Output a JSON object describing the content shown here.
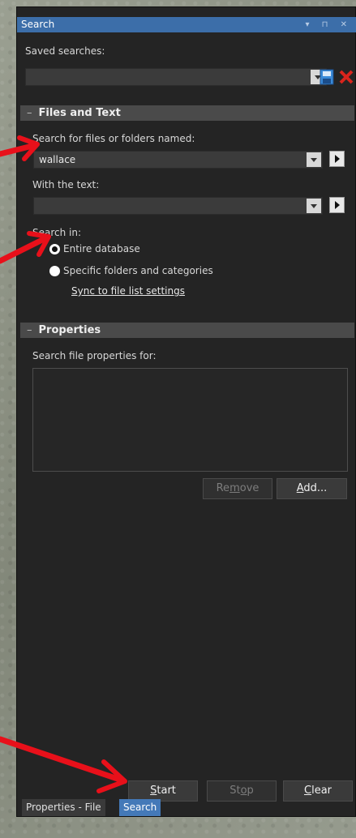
{
  "window": {
    "title": "Search",
    "controls": "▾ ⊓ ✕"
  },
  "saved_searches": {
    "label": "Saved searches:",
    "value": ""
  },
  "files_and_text": {
    "header": "Files and Text",
    "name_label": "Search for files or folders named:",
    "name_value": "wallace",
    "text_label": "With the text:",
    "text_value": "",
    "search_in_label": "Search in:",
    "options": [
      "Entire database",
      "Specific folders and categories"
    ],
    "selected_option": "Entire database",
    "sync_link": "Sync to file list settings"
  },
  "properties": {
    "header": "Properties",
    "search_label": "Search file properties for:",
    "remove_prefix": "Re",
    "remove_ul": "m",
    "remove_suffix": "ove",
    "add_ul": "A",
    "add_suffix": "dd..."
  },
  "actions": {
    "start_ul": "S",
    "start_suffix": "tart",
    "stop_prefix": "St",
    "stop_ul": "o",
    "stop_suffix": "p",
    "clear_ul": "C",
    "clear_suffix": "lear"
  },
  "bottom_tabs": [
    {
      "label": "Properties - File",
      "active": false
    },
    {
      "label": "Search",
      "active": true
    }
  ],
  "colors": {
    "titlebar": "#3c6ea9",
    "accent_arrow": "#e8101a",
    "active_tab": "#4479b8"
  }
}
